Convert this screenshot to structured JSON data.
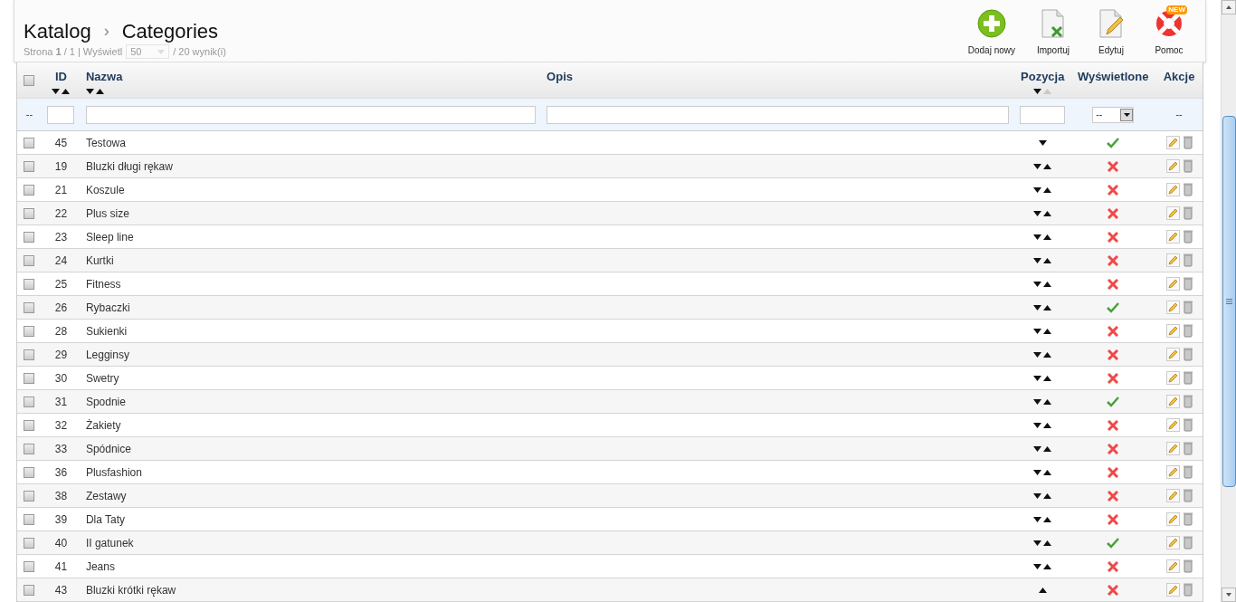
{
  "breadcrumb": {
    "section": "Katalog",
    "separator": "›",
    "page": "Categories"
  },
  "pagination": {
    "page_label": "Strona",
    "page": "1",
    "of": "/ 1 | Wyświetl",
    "per_page": "50",
    "total": "/ 20 wynik(i)"
  },
  "toolbar": [
    {
      "kind": "add",
      "label": "Dodaj nowy"
    },
    {
      "kind": "import",
      "label": "Importuj"
    },
    {
      "kind": "edit",
      "label": "Edytuj"
    },
    {
      "kind": "help",
      "label": "Pomoc",
      "badge": "NEW"
    }
  ],
  "table": {
    "select_all_checked": false,
    "columns": [
      {
        "label": "ID",
        "sort_arrows": true,
        "up_disabled": false
      },
      {
        "label": "Nazwa",
        "sort_arrows": true,
        "up_disabled": false
      },
      {
        "label": "Opis",
        "sort_arrows": false
      },
      {
        "label": "Pozycja",
        "sort_arrows": true,
        "up_disabled": true
      },
      {
        "label": "Wyświetlone",
        "sort_arrows": false
      },
      {
        "label": "Akcje",
        "sort_arrows": false
      }
    ],
    "filter": {
      "checkbox_cell": "--",
      "displayed_select": "--",
      "actions_cell": "--"
    },
    "rows": [
      {
        "checked": false,
        "id": "45",
        "name": "Testowa",
        "move_down": true,
        "move_up": false,
        "displayed": true
      },
      {
        "checked": false,
        "id": "19",
        "name": "Bluzki długi rękaw",
        "move_down": true,
        "move_up": true,
        "displayed": false
      },
      {
        "checked": false,
        "id": "21",
        "name": "Koszule",
        "move_down": true,
        "move_up": true,
        "displayed": false
      },
      {
        "checked": false,
        "id": "22",
        "name": "Plus size",
        "move_down": true,
        "move_up": true,
        "displayed": false
      },
      {
        "checked": false,
        "id": "23",
        "name": "Sleep line",
        "move_down": true,
        "move_up": true,
        "displayed": false
      },
      {
        "checked": false,
        "id": "24",
        "name": "Kurtki",
        "move_down": true,
        "move_up": true,
        "displayed": false
      },
      {
        "checked": false,
        "id": "25",
        "name": "Fitness",
        "move_down": true,
        "move_up": true,
        "displayed": false
      },
      {
        "checked": false,
        "id": "26",
        "name": "Rybaczki",
        "move_down": true,
        "move_up": true,
        "displayed": true
      },
      {
        "checked": false,
        "id": "28",
        "name": "Sukienki",
        "move_down": true,
        "move_up": true,
        "displayed": false
      },
      {
        "checked": false,
        "id": "29",
        "name": "Legginsy",
        "move_down": true,
        "move_up": true,
        "displayed": false
      },
      {
        "checked": false,
        "id": "30",
        "name": "Swetry",
        "move_down": true,
        "move_up": true,
        "displayed": false
      },
      {
        "checked": false,
        "id": "31",
        "name": "Spodnie",
        "move_down": true,
        "move_up": true,
        "displayed": true
      },
      {
        "checked": false,
        "id": "32",
        "name": "Żakiety",
        "move_down": true,
        "move_up": true,
        "displayed": false
      },
      {
        "checked": false,
        "id": "33",
        "name": "Spódnice",
        "move_down": true,
        "move_up": true,
        "displayed": false
      },
      {
        "checked": false,
        "id": "36",
        "name": "Plusfashion",
        "move_down": true,
        "move_up": true,
        "displayed": false
      },
      {
        "checked": false,
        "id": "38",
        "name": "Zestawy",
        "move_down": true,
        "move_up": true,
        "displayed": false
      },
      {
        "checked": false,
        "id": "39",
        "name": "Dla Taty",
        "move_down": true,
        "move_up": true,
        "displayed": false
      },
      {
        "checked": false,
        "id": "40",
        "name": "II gatunek",
        "move_down": true,
        "move_up": true,
        "displayed": true
      },
      {
        "checked": false,
        "id": "41",
        "name": "Jeans",
        "move_down": true,
        "move_up": true,
        "displayed": false
      },
      {
        "checked": false,
        "id": "43",
        "name": "Bluzki krótki rękaw",
        "move_down": false,
        "move_up": true,
        "displayed": false
      }
    ]
  }
}
